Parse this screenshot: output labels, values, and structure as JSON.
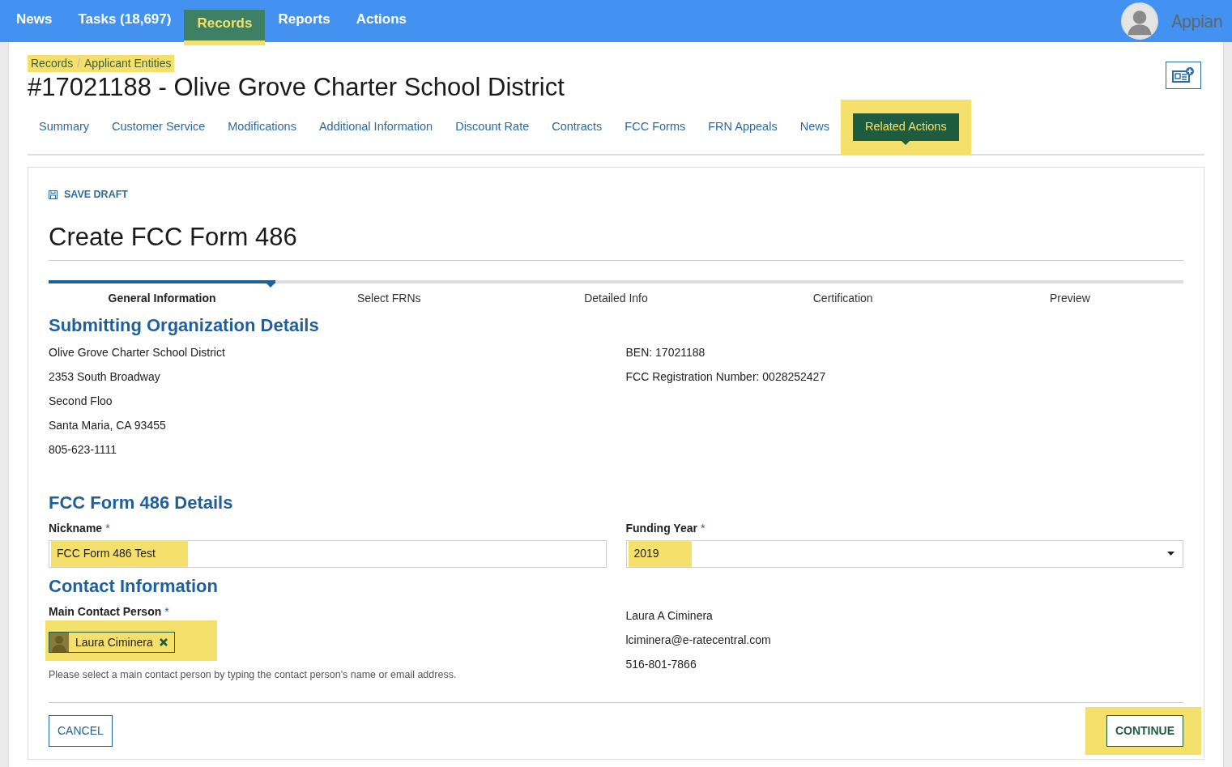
{
  "top_nav": {
    "items": [
      {
        "label": "News",
        "selected": false,
        "highlighted": false
      },
      {
        "label": "Tasks (18,697)",
        "selected": false,
        "highlighted": false
      },
      {
        "label": "Records",
        "selected": true,
        "highlighted": true
      },
      {
        "label": "Reports",
        "selected": false,
        "highlighted": false
      },
      {
        "label": "Actions",
        "selected": false,
        "highlighted": false
      }
    ],
    "logo": "Appian"
  },
  "breadcrumbs": {
    "items": [
      "Records",
      "Applicant Entities"
    ],
    "separator": "/",
    "highlighted": true
  },
  "record_title": "#17021188 - Olive Grove Charter School District",
  "record_tabs": [
    {
      "label": "Summary",
      "selected": false,
      "highlighted": false
    },
    {
      "label": "Customer Service",
      "selected": false,
      "highlighted": false
    },
    {
      "label": "Modifications",
      "selected": false,
      "highlighted": false
    },
    {
      "label": "Additional Information",
      "selected": false,
      "highlighted": false
    },
    {
      "label": "Discount Rate",
      "selected": false,
      "highlighted": false
    },
    {
      "label": "Contracts",
      "selected": false,
      "highlighted": false
    },
    {
      "label": "FCC Forms",
      "selected": false,
      "highlighted": false
    },
    {
      "label": "FRN Appeals",
      "selected": false,
      "highlighted": false
    },
    {
      "label": "News",
      "selected": false,
      "highlighted": false
    },
    {
      "label": "Related Actions",
      "selected": true,
      "highlighted": true
    }
  ],
  "form": {
    "save_draft": "SAVE DRAFT",
    "title": "Create FCC Form 486",
    "steps": [
      {
        "label": "General Information",
        "selected": true
      },
      {
        "label": "Select FRNs",
        "selected": false
      },
      {
        "label": "Detailed Info",
        "selected": false
      },
      {
        "label": "Certification",
        "selected": false
      },
      {
        "label": "Preview",
        "selected": false
      }
    ],
    "organization": {
      "heading": "Submitting Organization Details",
      "left_lines": [
        "Olive Grove Charter School District",
        "2353 South Broadway",
        "Second Floo",
        "Santa Maria, CA 93455",
        "805-623-1111"
      ],
      "right_lines": [
        "BEN: 17021188",
        "FCC Registration Number: 0028252427"
      ]
    },
    "details": {
      "heading": "FCC Form 486 Details",
      "nickname": {
        "label": "Nickname",
        "required_marker": "*",
        "value": "FCC Form 486 Test",
        "highlighted": true
      },
      "funding_year": {
        "label": "Funding Year",
        "required_marker": "*",
        "value": "2019",
        "highlighted": true
      }
    },
    "contact": {
      "heading": "Contact Information",
      "main_contact": {
        "label": "Main Contact Person",
        "required_marker": "*",
        "chip": "Laura Ciminera",
        "highlighted": true
      },
      "help": "Please select a main contact person by typing the contact person's name or email address.",
      "right_lines": [
        "Laura A Ciminera",
        "lciminera@e-ratecentral.com",
        "516-801-7866"
      ]
    },
    "buttons": [
      {
        "label": "CANCEL",
        "kind": "secondary",
        "highlighted": false
      },
      {
        "label": "CONTINUE",
        "kind": "primary",
        "highlighted": true
      }
    ]
  }
}
